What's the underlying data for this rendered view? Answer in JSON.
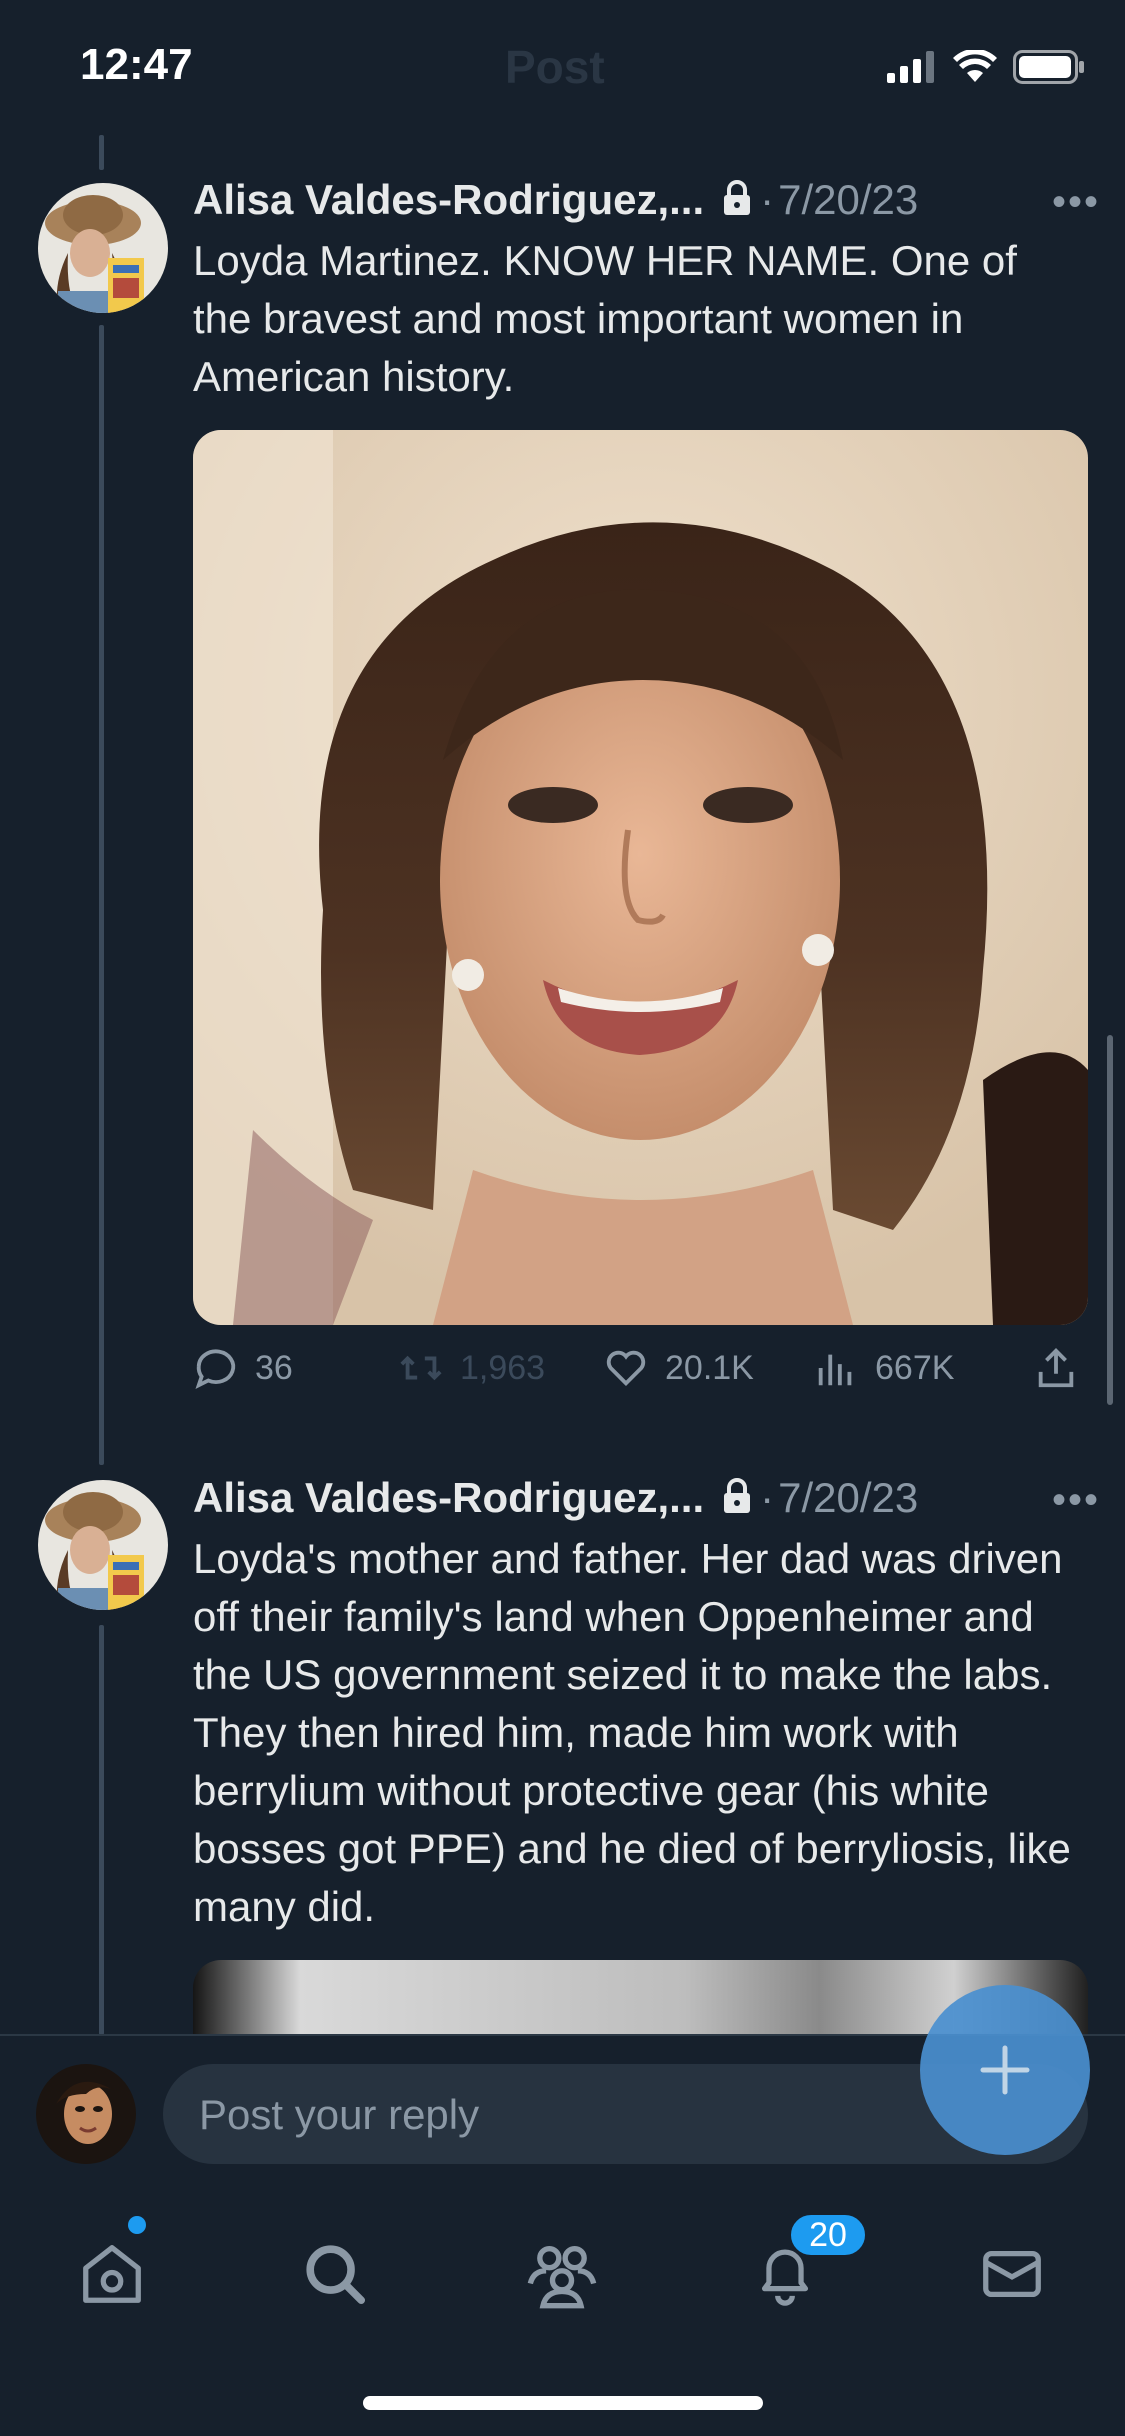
{
  "status_bar": {
    "time": "12:47",
    "ghost_title": "Post"
  },
  "posts": [
    {
      "author": "Alisa Valdes-Rodriguez,...",
      "date_sep": "·",
      "date": "7/20/23",
      "more": "•••",
      "text": "Loyda Martinez. KNOW HER NAME. One of the bravest and most important women in American history.",
      "stats": {
        "replies": "36",
        "reposts": "1,963",
        "likes": "20.1K",
        "views": "667K"
      }
    },
    {
      "author": "Alisa Valdes-Rodriguez,...",
      "date_sep": "·",
      "date": "7/20/23",
      "more": "•••",
      "text": "Loyda's mother and father. Her dad was driven off their family's land when Oppenheimer and the US government seized it to make the labs. They then hired him, made him work with berrylium without protective gear (his white bosses got PPE) and he died of berryliosis, like many did."
    }
  ],
  "reply": {
    "placeholder": "Post your reply"
  },
  "nav": {
    "notifications_badge": "20"
  },
  "icons": [
    "lock-icon",
    "more-icon",
    "reply-icon",
    "repost-icon",
    "like-icon",
    "views-icon",
    "share-icon",
    "plus-icon",
    "home-icon",
    "search-icon",
    "communities-icon",
    "notifications-icon",
    "messages-icon",
    "signal-icon",
    "wifi-icon",
    "battery-icon"
  ],
  "colors": {
    "background": "#16202c",
    "accent": "#1d9bf0",
    "muted": "#8b98a5",
    "text": "#e7e9ea"
  }
}
